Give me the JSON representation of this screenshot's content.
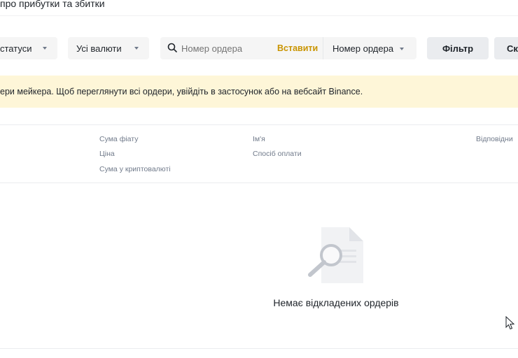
{
  "top_link": "про прибутки та збитки",
  "filters": {
    "status_label": "статуси",
    "currency_label": "Усі валюти",
    "search_placeholder": "Номер ордера",
    "paste_label": "Вставити",
    "search_type_label": "Номер ордера",
    "filter_button": "Фільтр",
    "next_button": "Ск"
  },
  "notice": {
    "text": "ери мейкера. Щоб переглянути всі ордери, увійдіть в застосунок або на вебсайт Binance."
  },
  "table": {
    "col_amount": {
      "fiat": "Сума фіату",
      "price": "Ціна",
      "crypto": "Сума у криптовалюті"
    },
    "col_counterparty": {
      "name": "Ім'я",
      "payment": "Спосіб оплати"
    },
    "col_responsible": "Відповідни"
  },
  "empty_state": {
    "message": "Немає відкладених ордерів"
  },
  "colors": {
    "accent": "#c99400",
    "notice_bg": "#fef6d8",
    "pill_bg": "#f5f5f5",
    "button_bg": "#eaecef"
  }
}
